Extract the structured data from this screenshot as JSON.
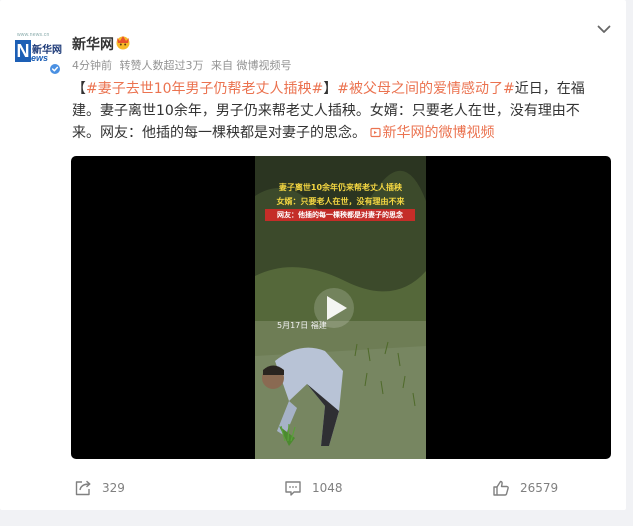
{
  "post": {
    "avatar": {
      "site": "www.news.cn",
      "n_letter": "N",
      "brand_text": "新华网",
      "ews_text": "ews"
    },
    "username": "新华网",
    "meta": {
      "time": "4分钟前",
      "reposters": "转赞人数超过3万",
      "source": "来自 微博视频号"
    },
    "text": {
      "open_bracket": "【",
      "hashtag1": "#妻子去世10年男子仍帮老丈人插秧#",
      "close_bracket": "】",
      "hashtag2": "#被父母之间的爱情感动了#",
      "body": "近日，在福建。妻子离世10余年，男子仍来帮老丈人插秧。女婿：只要老人在世，没有理由不来。网友：他插的每一棵秧都是对妻子的思念。",
      "video_link": "新华网的微博视频"
    },
    "video": {
      "caption1": "妻子离世10余年仍来帮老丈人插秧",
      "caption2": "女婿：只要老人在世，没有理由不来",
      "caption3": "网友：他插的每一棵秧都是对妻子的思念",
      "date": "5月17日 福建"
    }
  },
  "actions": {
    "repost_count": "329",
    "comment_count": "1048",
    "like_count": "26579"
  },
  "colors": {
    "accent": "#eb7350",
    "verify": "#4a90e2",
    "meta": "#939393"
  }
}
